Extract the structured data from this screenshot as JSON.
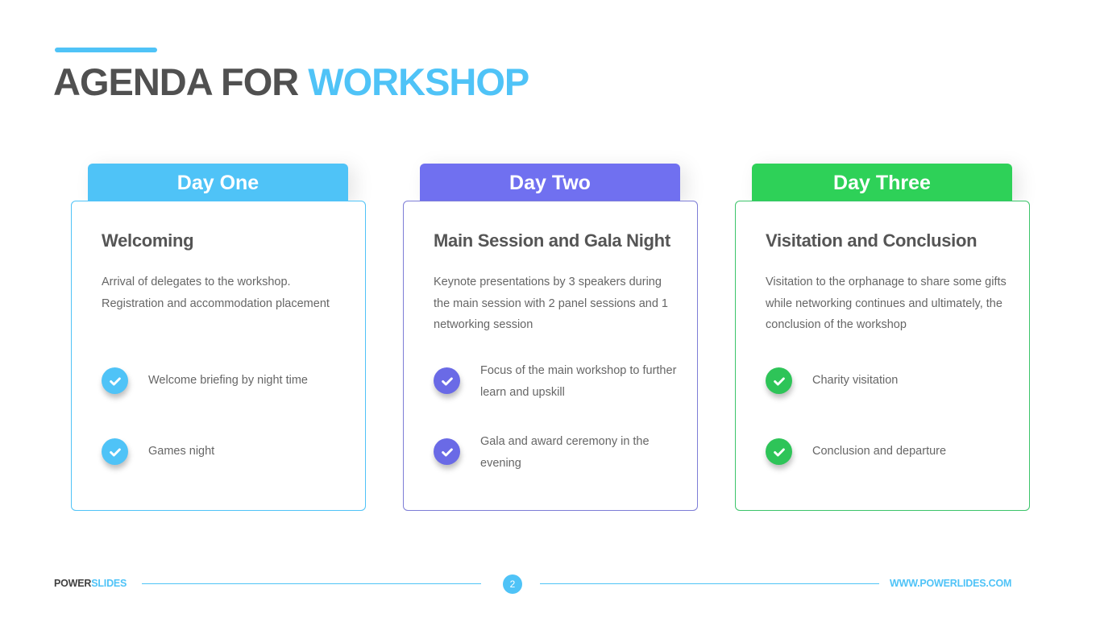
{
  "header": {
    "title_dark": "AGENDA FOR",
    "title_light": "WORKSHOP"
  },
  "colors": {
    "title_dark": "#505050",
    "accent": "#4fc3f7",
    "day_one": "#4fc3f7",
    "day_two": "#7070f0",
    "day_three": "#2ed158"
  },
  "days": [
    {
      "tab": "Day One",
      "title": "Welcoming",
      "description": "Arrival of delegates to the workshop. Registration and accommodation placement",
      "items": [
        {
          "icon": "check-circle-icon",
          "text": "Welcome briefing by night time"
        },
        {
          "icon": "check-circle-icon",
          "text": "Games night"
        }
      ]
    },
    {
      "tab": "Day Two",
      "title": "Main Session and Gala Night",
      "description": "Keynote presentations by 3 speakers during the main session with 2 panel sessions and 1 networking session",
      "items": [
        {
          "icon": "check-circle-icon",
          "text": "Focus of the main workshop to further learn and upskill"
        },
        {
          "icon": "check-circle-icon",
          "text": "Gala and award ceremony in the evening"
        }
      ]
    },
    {
      "tab": "Day Three",
      "title": "Visitation and Conclusion",
      "description": "Visitation to the orphanage to share some gifts while networking continues and ultimately, the conclusion of the workshop",
      "items": [
        {
          "icon": "check-circle-icon",
          "text": "Charity visitation"
        },
        {
          "icon": "check-circle-icon",
          "text": "Conclusion and departure"
        }
      ]
    }
  ],
  "footer": {
    "brand_dark": "POWER",
    "brand_light": "SLIDES",
    "page_number": "2",
    "url": "WWW.POWERLIDES.COM"
  }
}
